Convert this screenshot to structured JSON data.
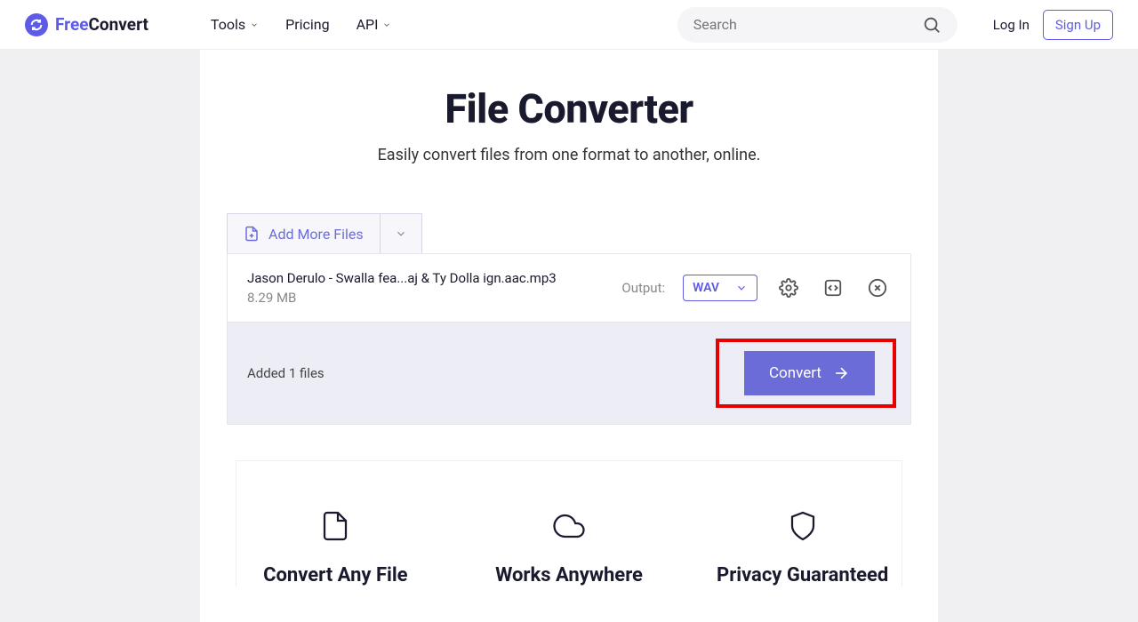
{
  "brand": {
    "free": "Free",
    "convert": "Convert"
  },
  "nav": {
    "tools": "Tools",
    "pricing": "Pricing",
    "api": "API"
  },
  "search": {
    "placeholder": "Search"
  },
  "auth": {
    "login": "Log In",
    "signup": "Sign Up"
  },
  "hero": {
    "title": "File Converter",
    "subtitle": "Easily convert files from one format to another, online."
  },
  "add_more": {
    "label": "Add More Files"
  },
  "file": {
    "name": "Jason Derulo - Swalla fea...aj & Ty Dolla ign.aac.mp3",
    "size": "8.29 MB",
    "output_label": "Output:",
    "output_format": "WAV"
  },
  "status": {
    "text": "Added 1 files",
    "convert": "Convert"
  },
  "features": {
    "f1": "Convert Any File",
    "f2": "Works Anywhere",
    "f3": "Privacy Guaranteed"
  }
}
